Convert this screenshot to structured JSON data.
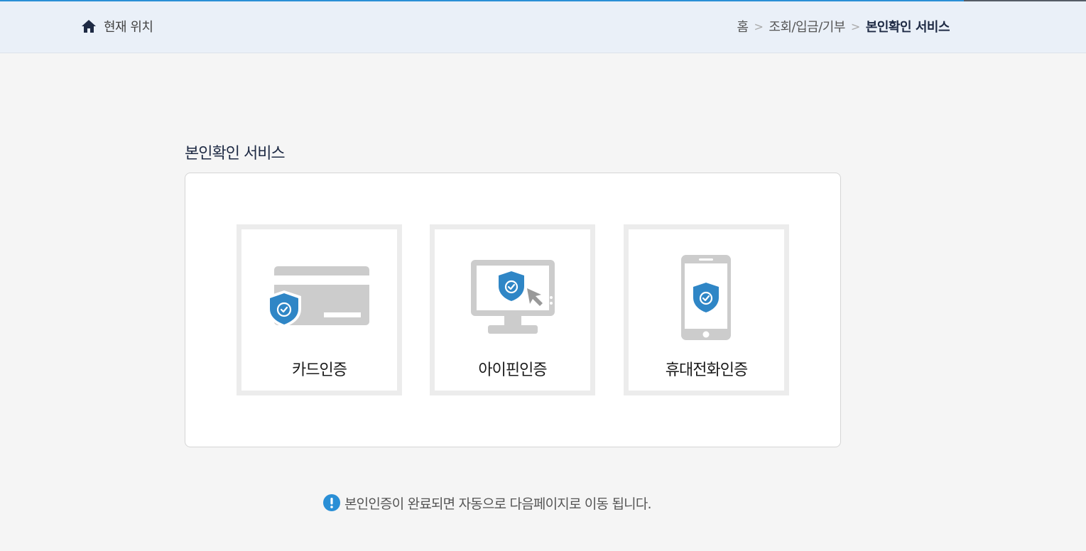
{
  "header": {
    "location_label": "현재 위치",
    "breadcrumb": {
      "home": "홈",
      "category": "조회/입금/기부",
      "current": "본인확인 서비스",
      "separator": ">"
    }
  },
  "main": {
    "title": "본인확인 서비스",
    "options": [
      {
        "label": "카드인증",
        "icon": "credit-card-shield-icon"
      },
      {
        "label": "아이핀인증",
        "icon": "monitor-shield-icon"
      },
      {
        "label": "휴대전화인증",
        "icon": "mobile-phone-shield-icon"
      }
    ],
    "notice": "본인인증이 완료되면 자동으로 다음페이지로 이동 됩니다."
  },
  "colors": {
    "accent": "#2a8fd6",
    "shield": "#2f86c6",
    "device_gray": "#cccccc",
    "title_navy": "#1e2a44"
  }
}
